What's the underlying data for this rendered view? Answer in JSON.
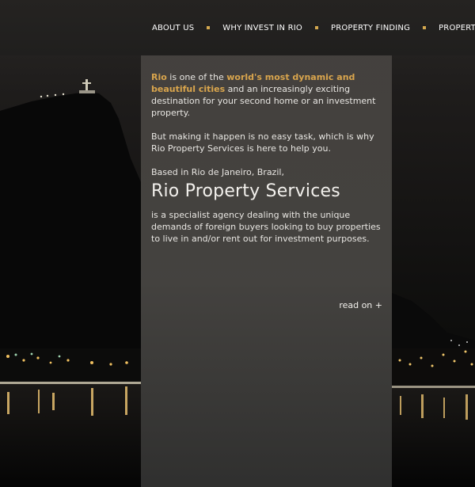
{
  "nav": {
    "items": [
      "ABOUT US",
      "WHY INVEST IN RIO",
      "PROPERTY FINDING",
      "PROPERTY"
    ]
  },
  "content": {
    "intro_city": "Rio",
    "intro_is": " is one of the ",
    "intro_highlight": "world's most dynamic and beautiful cities",
    "intro_rest": " and an increasingly exciting destination for your second home or an investment property.",
    "para2": "But making it happen is no easy task, which is why Rio Property Services is here to help you.",
    "para3": "Based in Rio de Janeiro, Brazil,",
    "brand": "Rio Property Services",
    "para4": "is a specialist agency dealing with the unique demands of foreign buyers looking to buy properties to live in and/or rent out for investment purposes.",
    "read_more": "read on +"
  },
  "colors": {
    "accent": "#d9a54d",
    "nav_separator": "#d4a84f",
    "text": "#e8e6e2"
  }
}
